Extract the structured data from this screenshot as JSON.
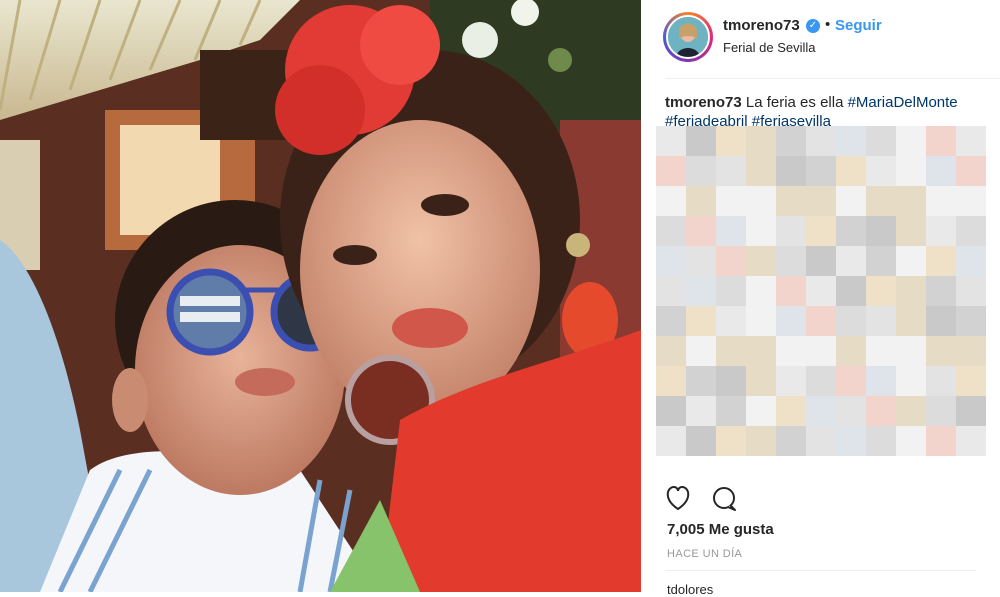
{
  "post": {
    "username": "tmoreno73",
    "verified": true,
    "follow_label": "Seguir",
    "separator": "•",
    "location": "Ferial de Sevilla",
    "caption_username": "tmoreno73",
    "caption_text": "La feria es ella",
    "hashtags": [
      "#MariaDelMonte",
      "#feriadeabril",
      "#feriasevilla"
    ],
    "likes": "7,005 Me gusta",
    "timestamp": "HACE UN DÍA",
    "next_comment_partial": "tdolores"
  },
  "icons": {
    "verified": "verified-check-icon",
    "like": "heart-icon",
    "comment": "comment-bubble-icon"
  },
  "colors": {
    "link": "#003569",
    "follow": "#3897f0",
    "muted": "#999999",
    "text": "#262626"
  }
}
